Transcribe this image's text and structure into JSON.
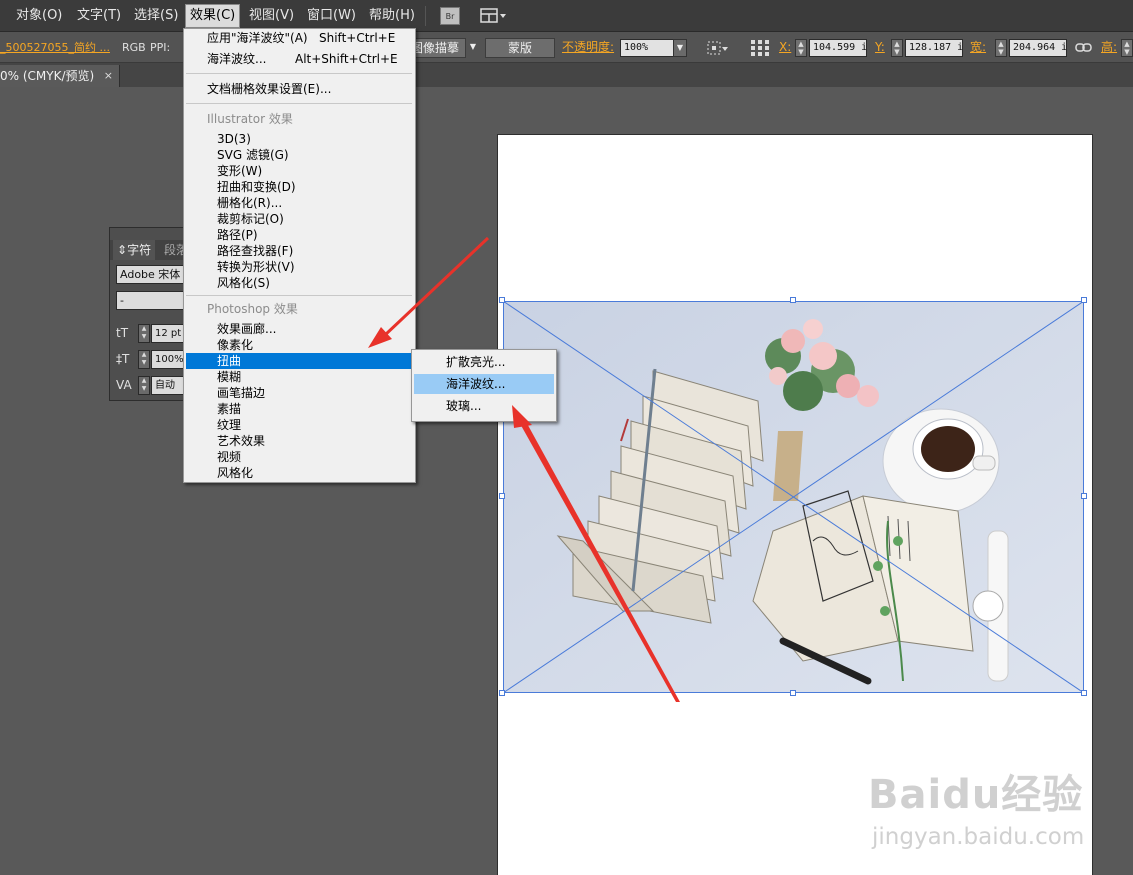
{
  "menubar": {
    "items": [
      {
        "label": "对象(O)"
      },
      {
        "label": "文字(T)"
      },
      {
        "label": "选择(S)"
      },
      {
        "label": "效果(C)"
      },
      {
        "label": "视图(V)"
      },
      {
        "label": "窗口(W)"
      },
      {
        "label": "帮助(H)"
      }
    ],
    "bridge_label": "Br",
    "workspace_icon": "workspace-grid-icon"
  },
  "control_bar": {
    "file_name": "_500527055_简约 ...",
    "color_mode": "RGB",
    "ppi_label": "PPI:",
    "trace_button": "图像描摹",
    "mask_button": "蒙版",
    "opacity_label": "不透明度:",
    "opacity_value": "100%",
    "x_label": "X:",
    "x_value": "104.599 i",
    "y_label": "Y:",
    "y_value": "128.187 i",
    "width_label": "宽:",
    "width_value": "204.964 i",
    "height_label": "高:"
  },
  "document_tab": {
    "title": "0% (CMYK/预览)",
    "close": "×"
  },
  "char_panel": {
    "tab_character": "字符",
    "tab_paragraph": "段落",
    "font_family": "Adobe 宋体",
    "font_style": "-",
    "font_size": "12 pt",
    "leading": "100%",
    "tracking": "自动"
  },
  "effect_menu": {
    "apply_last": {
      "label": "应用\"海洋波纹\"(A)",
      "shortcut": "Shift+Ctrl+E"
    },
    "last_effect": {
      "label": "海洋波纹...",
      "shortcut": "Alt+Shift+Ctrl+E"
    },
    "doc_raster": "文档栅格效果设置(E)...",
    "illustrator_header": "Illustrator 效果",
    "illustrator_items": [
      "3D(3)",
      "SVG 滤镜(G)",
      "变形(W)",
      "扭曲和变换(D)",
      "栅格化(R)...",
      "裁剪标记(O)",
      "路径(P)",
      "路径查找器(F)",
      "转换为形状(V)",
      "风格化(S)"
    ],
    "photoshop_header": "Photoshop 效果",
    "photoshop_items": [
      "效果画廊...",
      "像素化",
      "扭曲",
      "模糊",
      "画笔描边",
      "素描",
      "纹理",
      "艺术效果",
      "视频",
      "风格化"
    ],
    "highlighted_item": "扭曲"
  },
  "distort_submenu": {
    "items": [
      "扩散亮光...",
      "海洋波纹...",
      "玻璃..."
    ],
    "highlighted_item": "海洋波纹..."
  },
  "watermark": {
    "logo": "Bai经验",
    "logo_du": "du",
    "url": "jingyan.baidu.com"
  },
  "colors": {
    "menu_highlight": "#0078d7",
    "submenu_highlight": "#99cbf5",
    "arrow": "#e8322a",
    "accent_label": "#f5a623",
    "selection": "#4a7bd9"
  }
}
